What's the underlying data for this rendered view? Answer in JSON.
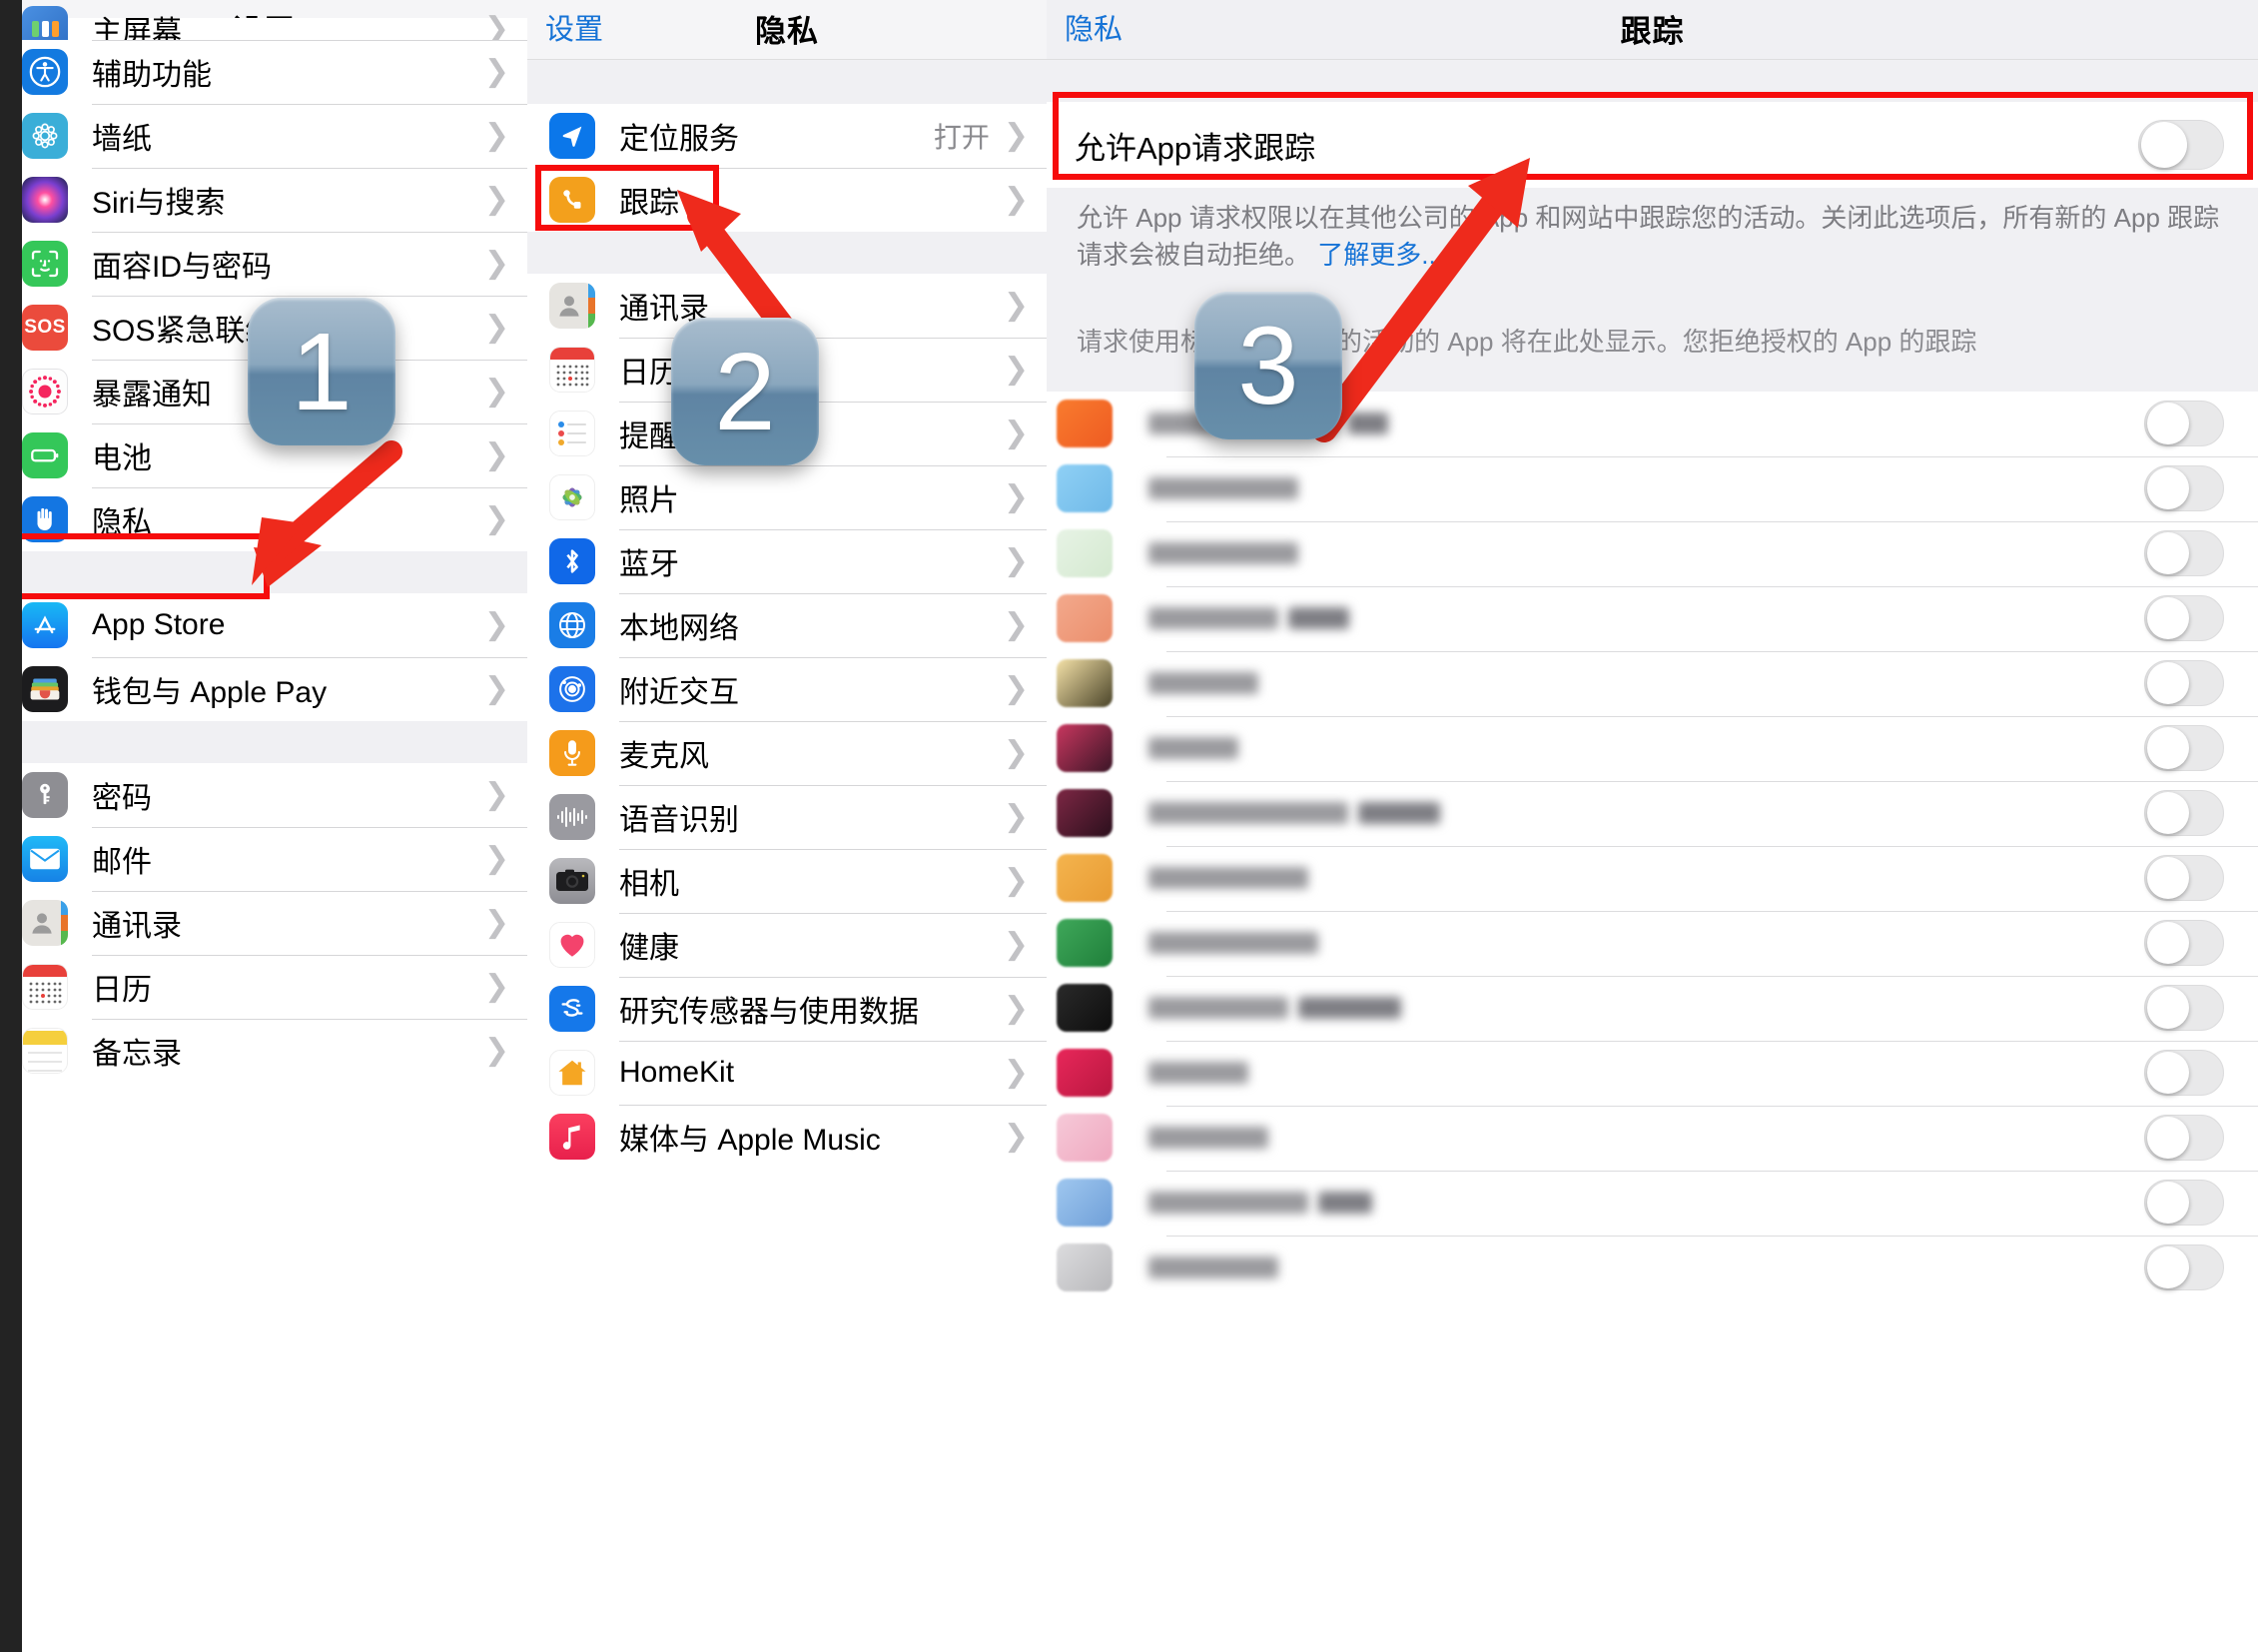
{
  "panels": {
    "left": {
      "title": "设置",
      "items": [
        {
          "label": "主屏幕",
          "icon": "homescreen-icon",
          "partial": true
        },
        {
          "label": "辅助功能",
          "icon": "accessibility-icon"
        },
        {
          "label": "墙纸",
          "icon": "wallpaper-icon"
        },
        {
          "label": "Siri与搜索",
          "icon": "siri-icon"
        },
        {
          "label": "面容ID与密码",
          "icon": "faceid-icon"
        },
        {
          "label": "SOS紧急联络",
          "icon": "sos-icon"
        },
        {
          "label": "暴露通知",
          "icon": "exposure-notification-icon"
        },
        {
          "label": "电池",
          "icon": "battery-icon"
        },
        {
          "label": "隐私",
          "icon": "privacy-hand-icon"
        }
      ],
      "group2": [
        {
          "label": "App Store",
          "icon": "appstore-icon"
        },
        {
          "label": "钱包与 Apple Pay",
          "icon": "wallet-icon"
        }
      ],
      "group3": [
        {
          "label": "密码",
          "icon": "passwords-key-icon"
        },
        {
          "label": "邮件",
          "icon": "mail-icon"
        },
        {
          "label": "通讯录",
          "icon": "contacts-icon"
        },
        {
          "label": "日历",
          "icon": "calendar-icon"
        },
        {
          "label": "备忘录",
          "icon": "notes-icon"
        }
      ]
    },
    "middle": {
      "back": "设置",
      "title": "隐私",
      "group1": [
        {
          "label": "定位服务",
          "value": "打开",
          "icon": "location-arrow-icon"
        },
        {
          "label": "跟踪",
          "value": "",
          "icon": "tracking-icon"
        }
      ],
      "group2": [
        {
          "label": "通讯录",
          "icon": "contacts-icon"
        },
        {
          "label": "日历",
          "icon": "calendar-icon"
        },
        {
          "label": "提醒事项",
          "icon": "reminders-icon"
        },
        {
          "label": "照片",
          "icon": "photos-icon"
        },
        {
          "label": "蓝牙",
          "icon": "bluetooth-icon"
        },
        {
          "label": "本地网络",
          "icon": "local-network-icon"
        },
        {
          "label": "附近交互",
          "icon": "nearby-interactions-icon"
        },
        {
          "label": "麦克风",
          "icon": "microphone-icon"
        },
        {
          "label": "语音识别",
          "icon": "speech-recognition-icon"
        },
        {
          "label": "相机",
          "icon": "camera-icon"
        },
        {
          "label": "健康",
          "icon": "health-icon"
        },
        {
          "label": "研究传感器与使用数据",
          "icon": "research-sensor-icon"
        },
        {
          "label": "HomeKit",
          "icon": "homekit-icon"
        },
        {
          "label": "媒体与 Apple Music",
          "icon": "media-apple-music-icon"
        }
      ]
    },
    "right": {
      "back": "隐私",
      "title": "跟踪",
      "toggle_label": "允许App请求跟踪",
      "toggle_on": false,
      "description": "允许 App 请求权限以在其他公司的 App 和网站中跟踪您的活动。关闭此选项后，所有新的 App 跟踪请求会被自动拒绝。",
      "description_link": "了解更多...",
      "description2": "请求使用标识符跟踪您的活动的 App 将在此处显示。您拒绝授权的 App 的跟踪",
      "app_rows": 14
    }
  },
  "annotations": {
    "steps": [
      {
        "number": "1",
        "target": "隐私"
      },
      {
        "number": "2",
        "target": "跟踪"
      },
      {
        "number": "3",
        "target": "允许App请求跟踪"
      }
    ],
    "highlight_color": "#f60c0c",
    "arrow_color": "#ef2a1d"
  }
}
